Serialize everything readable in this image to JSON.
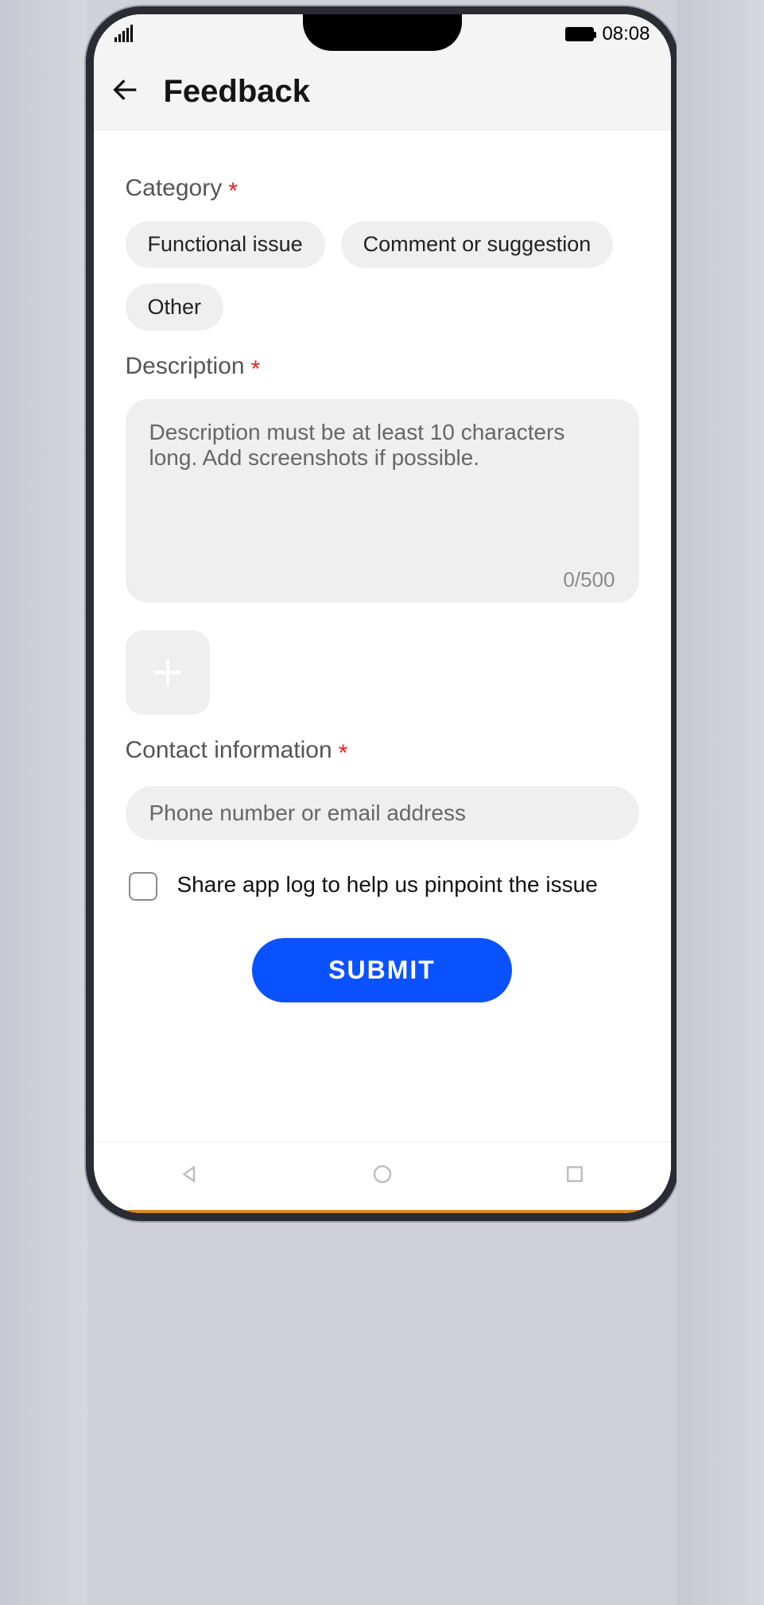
{
  "status": {
    "time": "08:08"
  },
  "header": {
    "title": "Feedback"
  },
  "category": {
    "label": "Category",
    "options": [
      "Functional issue",
      "Comment or suggestion",
      "Other"
    ]
  },
  "description": {
    "label": "Description",
    "placeholder": "Description must be at least 10 characters long. Add screenshots if possible.",
    "counter": "0/500"
  },
  "contact": {
    "label": "Contact information",
    "placeholder": "Phone number or email address"
  },
  "share_log": {
    "label": "Share app log to help us pinpoint the issue",
    "checked": false
  },
  "submit_label": "SUBMIT",
  "required_mark": "*"
}
